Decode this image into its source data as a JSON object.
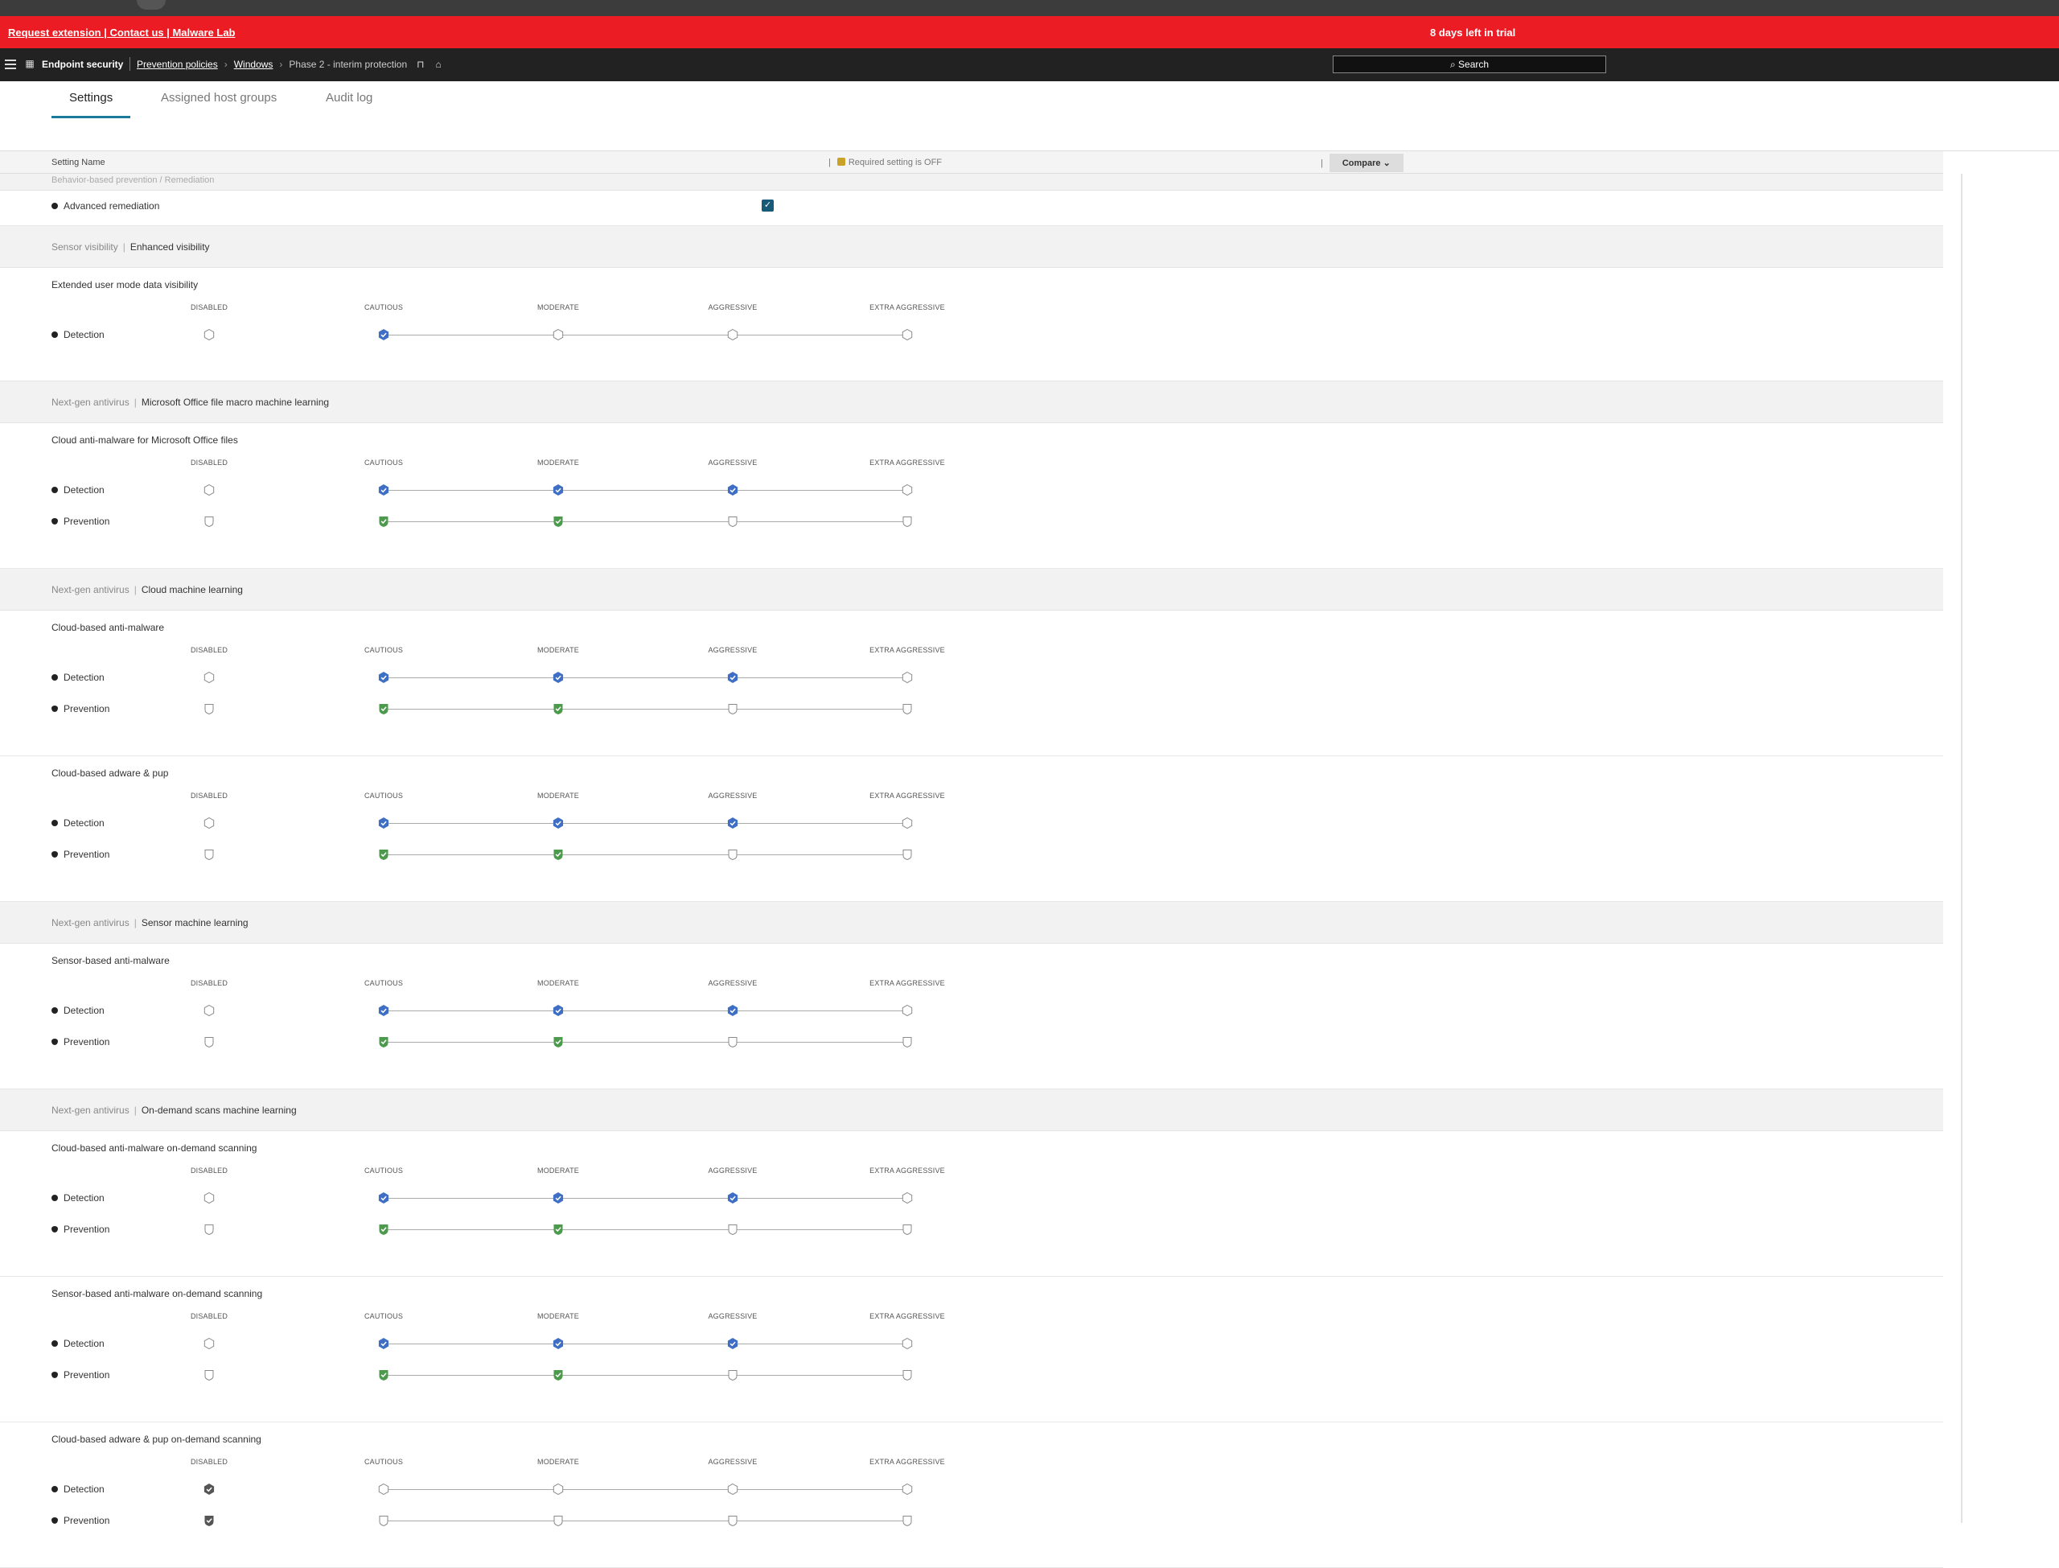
{
  "banner": {
    "links": "Request extension | Contact us | Malware Lab",
    "trial": "8 days left in trial"
  },
  "topnav": {
    "app": "Endpoint security",
    "crumbs": [
      "Prevention policies",
      "Windows"
    ],
    "current": "Phase 2 - interim protection",
    "search": "Search"
  },
  "tabs": [
    "Settings",
    "Assigned host groups",
    "Audit log"
  ],
  "header": {
    "setting_name": "Setting Name",
    "required": "Required setting is OFF",
    "compare": "Compare"
  },
  "levels": [
    "DISABLED",
    "CAUTIOUS",
    "MODERATE",
    "AGGRESSIVE",
    "EXTRA AGGRESSIVE"
  ],
  "strip_text": "Behavior-based prevention / Remediation",
  "advanced_remediation": {
    "label": "Advanced remediation",
    "checked": true
  },
  "sections": [
    {
      "category": "Sensor visibility",
      "subcategory": "Enhanced visibility",
      "blocks": [
        {
          "title": "Extended user mode data visibility",
          "rows": [
            {
              "label": "Detection",
              "kind": "detection",
              "level": 1
            }
          ]
        }
      ]
    },
    {
      "category": "Next-gen antivirus",
      "subcategory": "Microsoft Office file macro machine learning",
      "blocks": [
        {
          "title": "Cloud anti-malware for Microsoft Office files",
          "rows": [
            {
              "label": "Detection",
              "kind": "detection",
              "level": 3
            },
            {
              "label": "Prevention",
              "kind": "prevention",
              "level": 2
            }
          ]
        }
      ]
    },
    {
      "category": "Next-gen antivirus",
      "subcategory": "Cloud machine learning",
      "blocks": [
        {
          "title": "Cloud-based anti-malware",
          "rows": [
            {
              "label": "Detection",
              "kind": "detection",
              "level": 3
            },
            {
              "label": "Prevention",
              "kind": "prevention",
              "level": 2
            }
          ]
        },
        {
          "title": "Cloud-based adware & pup",
          "rows": [
            {
              "label": "Detection",
              "kind": "detection",
              "level": 3
            },
            {
              "label": "Prevention",
              "kind": "prevention",
              "level": 2
            }
          ]
        }
      ]
    },
    {
      "category": "Next-gen antivirus",
      "subcategory": "Sensor machine learning",
      "blocks": [
        {
          "title": "Sensor-based anti-malware",
          "rows": [
            {
              "label": "Detection",
              "kind": "detection",
              "level": 3
            },
            {
              "label": "Prevention",
              "kind": "prevention",
              "level": 2
            }
          ]
        }
      ]
    },
    {
      "category": "Next-gen antivirus",
      "subcategory": "On-demand scans machine learning",
      "blocks": [
        {
          "title": "Cloud-based anti-malware on-demand scanning",
          "rows": [
            {
              "label": "Detection",
              "kind": "detection",
              "level": 3
            },
            {
              "label": "Prevention",
              "kind": "prevention",
              "level": 2
            }
          ]
        },
        {
          "title": "Sensor-based anti-malware on-demand scanning",
          "rows": [
            {
              "label": "Detection",
              "kind": "detection",
              "level": 3
            },
            {
              "label": "Prevention",
              "kind": "prevention",
              "level": 2
            }
          ]
        },
        {
          "title": "Cloud-based adware & pup on-demand scanning",
          "rows": [
            {
              "label": "Detection",
              "kind": "detection",
              "level": 0
            },
            {
              "label": "Prevention",
              "kind": "prevention",
              "level": 0
            }
          ]
        }
      ]
    }
  ],
  "colors": {
    "banner": "#ec1c24",
    "detection_on": "#3f6fc4",
    "prevention_on": "#4c9a4c",
    "disabled_on": "#555555",
    "accent": "#1a7a9a"
  }
}
